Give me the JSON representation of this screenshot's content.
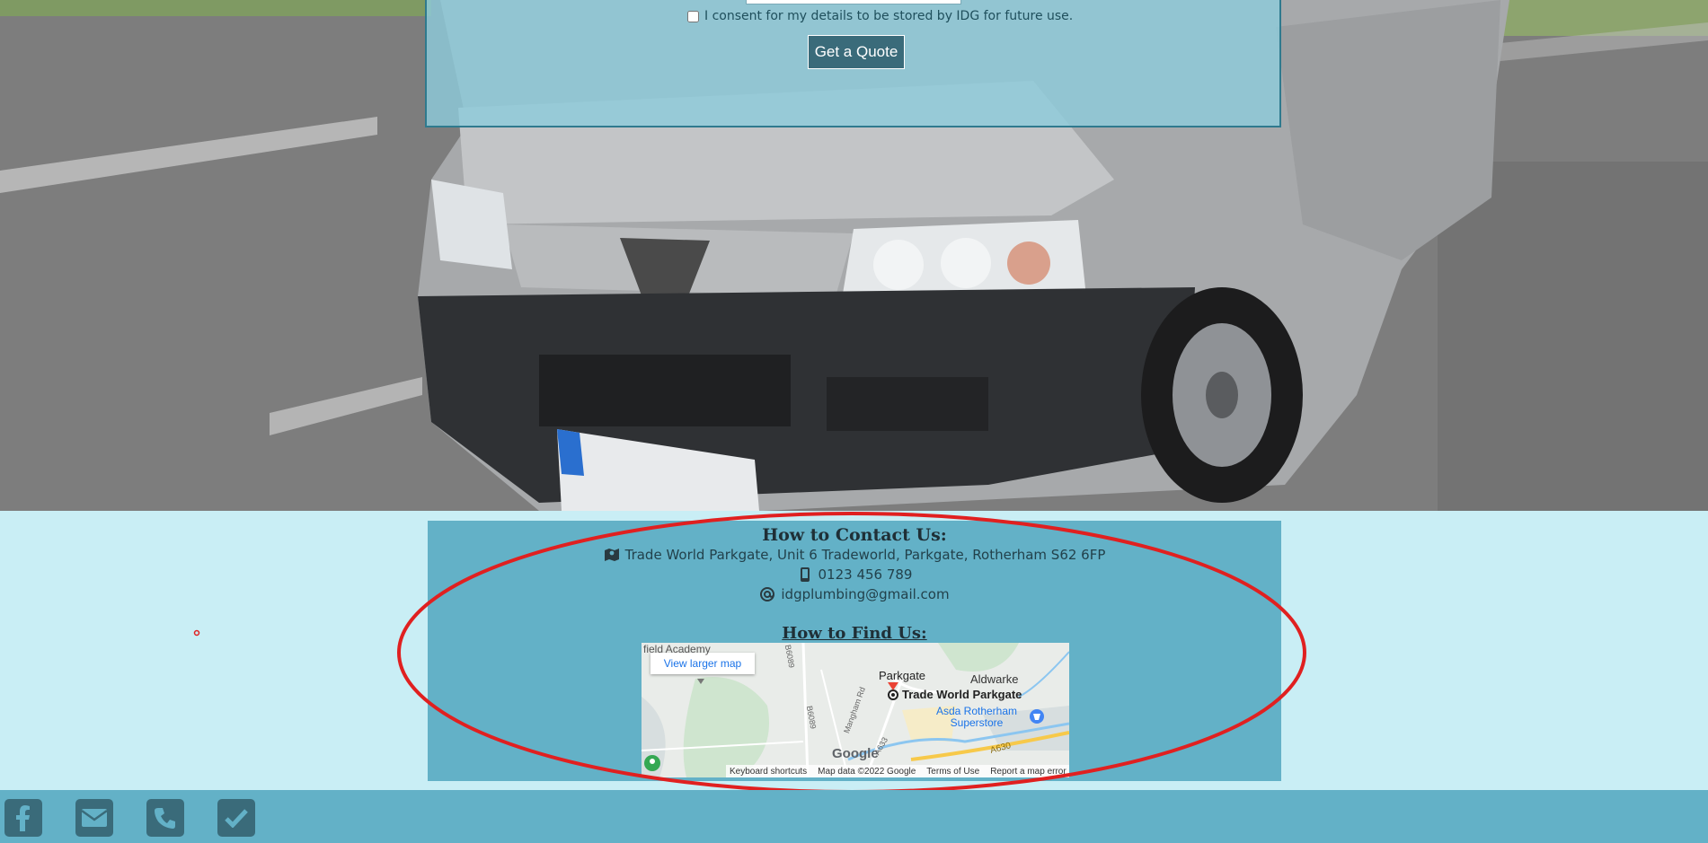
{
  "quote_form": {
    "consent_label": "I consent for my details to be stored by IDG for future use.",
    "submit_label": "Get a Quote"
  },
  "contact": {
    "title": "How to Contact Us:",
    "address": "Trade World Parkgate, Unit 6 Tradeworld, Parkgate, Rotherham S62 6FP",
    "phone": "0123 456 789",
    "email": "idgplumbing@gmail.com",
    "address_icon": "map-icon",
    "phone_icon": "mobile-phone-icon",
    "email_icon": "at-icon"
  },
  "find": {
    "title": "How to Find Us:"
  },
  "map": {
    "larger_map_label": "View larger map",
    "places": [
      "field Academy",
      "Parkgate",
      "Aldwarke",
      "Trade World Parkgate",
      "Asda Rotherham Superstore"
    ],
    "roads": [
      "B6089",
      "B6089",
      "Mangham Rd",
      "A633",
      "A630"
    ],
    "footer": {
      "shortcuts": "Keyboard shortcuts",
      "map_data": "Map data ©2022 Google",
      "terms": "Terms of Use",
      "report": "Report a map error"
    },
    "logo": "Google"
  },
  "footer": {
    "icons": [
      "facebook-icon",
      "mail-icon",
      "phone-icon",
      "check-icon"
    ]
  },
  "colors": {
    "accent_dark": "#3a6b7a",
    "panel": "#63b1c7",
    "band": "#c9eef5",
    "annotation": "#e02020"
  }
}
